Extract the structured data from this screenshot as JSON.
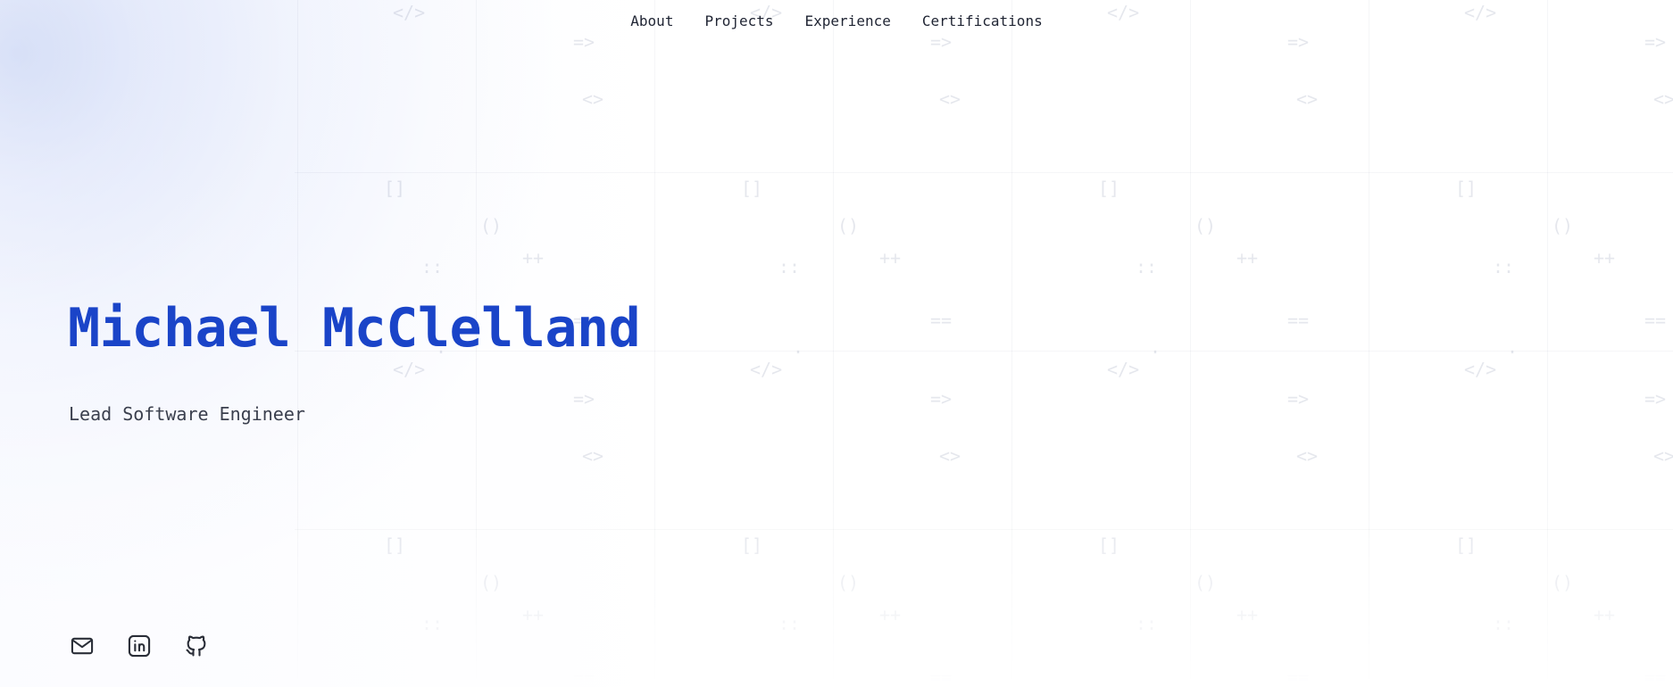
{
  "nav": {
    "items": [
      {
        "label": "About"
      },
      {
        "label": "Projects"
      },
      {
        "label": "Experience"
      },
      {
        "label": "Certifications"
      }
    ]
  },
  "hero": {
    "name": "Michael McClelland",
    "title": "Lead Software Engineer"
  },
  "social": [
    {
      "icon": "mail-icon"
    },
    {
      "icon": "linkedin-icon"
    },
    {
      "icon": "github-icon"
    }
  ],
  "background": {
    "glyphs": [
      "</>",
      "=>",
      "<>",
      "[]",
      "()",
      "++",
      "::",
      "==",
      "."
    ]
  },
  "colors": {
    "accent": "#1a44c8",
    "text": "#1f2433",
    "subtitle": "#3a3f4d",
    "glow": "#c5d2f3"
  }
}
